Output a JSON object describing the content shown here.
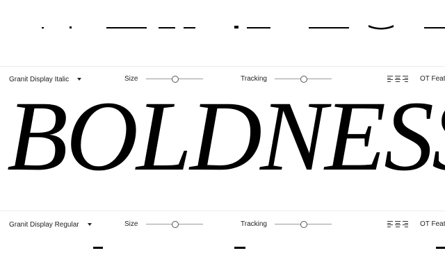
{
  "specimens": [
    {
      "font_label": "Granit Display Italic",
      "size_label": "Size",
      "size_value": 0.5,
      "tracking_label": "Tracking",
      "tracking_value": 0.5,
      "ot_label": "OT Features",
      "sample_text": "BOLDNESS"
    },
    {
      "font_label": "Granit Display Regular",
      "size_label": "Size",
      "size_value": 0.5,
      "tracking_label": "Tracking",
      "tracking_value": 0.5,
      "ot_label": "OT Features"
    }
  ],
  "icons": {
    "caret": "chevron-down-icon",
    "align_left": "align-left-icon",
    "align_center": "align-center-icon",
    "align_right": "align-right-icon"
  }
}
